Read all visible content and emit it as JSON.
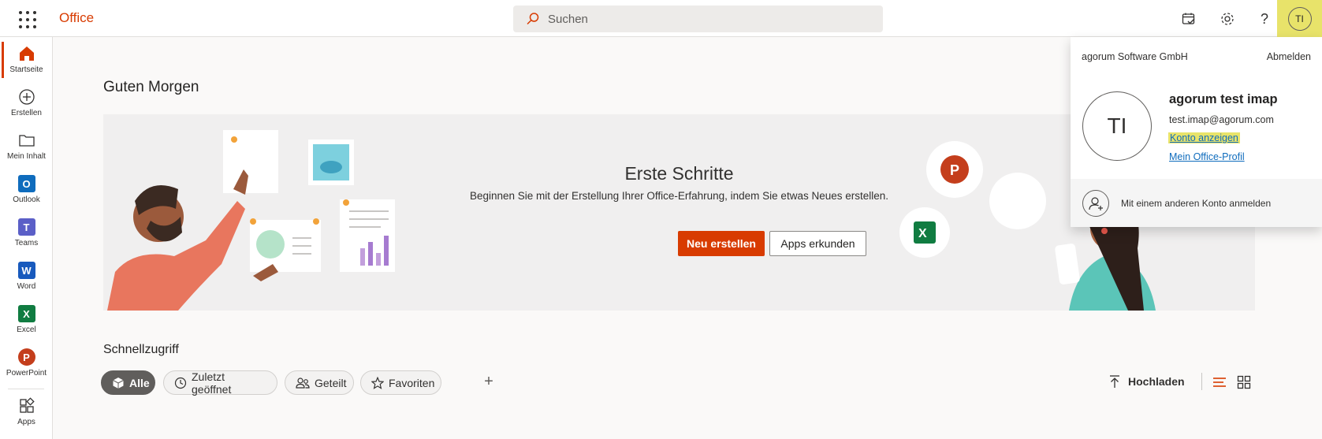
{
  "topbar": {
    "brand": "Office",
    "search_placeholder": "Suchen",
    "avatar_initials": "TI"
  },
  "rail": {
    "items": [
      {
        "label": "Startseite"
      },
      {
        "label": "Erstellen"
      },
      {
        "label": "Mein Inhalt"
      },
      {
        "label": "Outlook"
      },
      {
        "label": "Teams"
      },
      {
        "label": "Word"
      },
      {
        "label": "Excel"
      },
      {
        "label": "PowerPoint"
      },
      {
        "label": "Apps"
      }
    ]
  },
  "main": {
    "greeting": "Guten Morgen",
    "hero": {
      "title": "Erste Schritte",
      "subtitle": "Beginnen Sie mit der Erstellung Ihrer Office-Erfahrung, indem Sie etwas Neues erstellen.",
      "primary_button": "Neu erstellen",
      "secondary_button": "Apps erkunden"
    },
    "quick_access": {
      "title": "Schnellzugriff",
      "filters": [
        {
          "label": "Alle"
        },
        {
          "label": "Zuletzt geöffnet"
        },
        {
          "label": "Geteilt"
        },
        {
          "label": "Favoriten"
        }
      ],
      "add_symbol": "+",
      "upload_label": "Hochladen"
    }
  },
  "account": {
    "company": "agorum Software GmbH",
    "sign_out": "Abmelden",
    "initials": "TI",
    "name": "agorum test imap",
    "email": "test.imap@agorum.com",
    "view_account": "Konto anzeigen",
    "office_profile": "Mein Office-Profil",
    "other_account": "Mit einem anderen Konto anmelden"
  },
  "colors": {
    "accent": "#d83b01",
    "highlight": "#e8e36a",
    "link": "#0f6cbd"
  }
}
